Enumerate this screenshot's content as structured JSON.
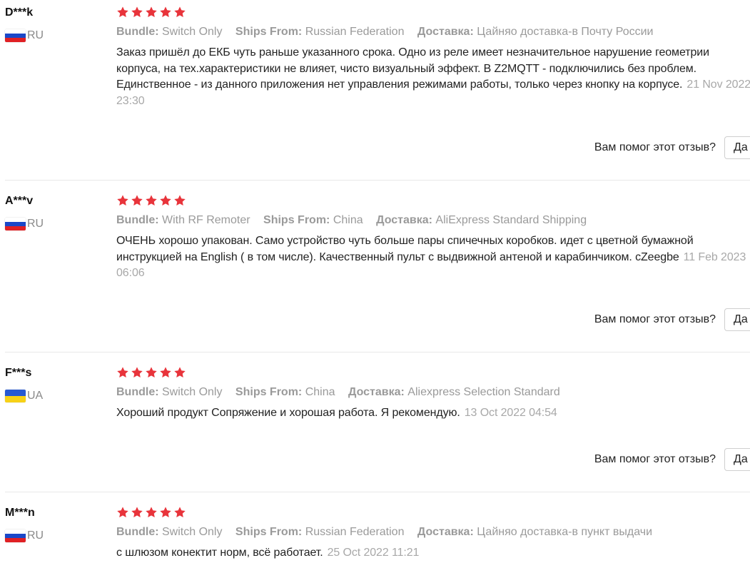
{
  "labels": {
    "bundle": "Bundle:",
    "ships_from": "Ships From:",
    "delivery": "Доставка:",
    "helpful_question": "Вам помог этот отзыв?",
    "yes": "Да"
  },
  "colors": {
    "star": "#e8343b",
    "meta_gray": "#9a9a9a",
    "date_gray": "#a8a8a8"
  },
  "reviews": [
    {
      "user": "D***k",
      "country": "RU",
      "flag": "ru-flag-icon",
      "rating": 5,
      "bundle": "Switch Only",
      "ships_from": "Russian Federation",
      "delivery": "Цайняо доставка-в Почту России",
      "text": "Заказ пришёл до ЕКБ чуть раньше указанного срока. Одно из реле имеет незначительное нарушение геометрии корпуса, на тех.характеристики не влияет, чисто визуальный эффект. В Z2MQTT - подключились без проблем. Единственное - из данного приложения нет управления режимами работы, только через кнопку на корпусе.",
      "date": "21 Nov 2022 23:30"
    },
    {
      "user": "A***v",
      "country": "RU",
      "flag": "ru-flag-icon",
      "rating": 5,
      "bundle": "With RF Remoter",
      "ships_from": "China",
      "delivery": "AliExpress Standard Shipping",
      "text": "ОЧЕНЬ хорошо упакован. Само устройство чуть больше пары спичечных коробков. идет с цветной бумажной инструкцией на English ( в том числе). Качественный пульт с выдвижной антеной и карабинчиком. cZeegbe",
      "date": "11 Feb 2023 06:06"
    },
    {
      "user": "F***s",
      "country": "UA",
      "flag": "ua-flag-icon",
      "rating": 5,
      "bundle": "Switch Only",
      "ships_from": "China",
      "delivery": "Aliexpress Selection Standard",
      "text": "Хороший продукт Сопряжение и хорошая работа. Я рекомендую.",
      "date": "13 Oct 2022 04:54"
    },
    {
      "user": "M***n",
      "country": "RU",
      "flag": "ru-flag-icon",
      "rating": 5,
      "bundle": "Switch Only",
      "ships_from": "Russian Federation",
      "delivery": "Цайняо доставка-в пункт выдачи",
      "text": "с шлюзом конектит норм, всё работает.",
      "date": "25 Oct 2022 11:21"
    }
  ]
}
